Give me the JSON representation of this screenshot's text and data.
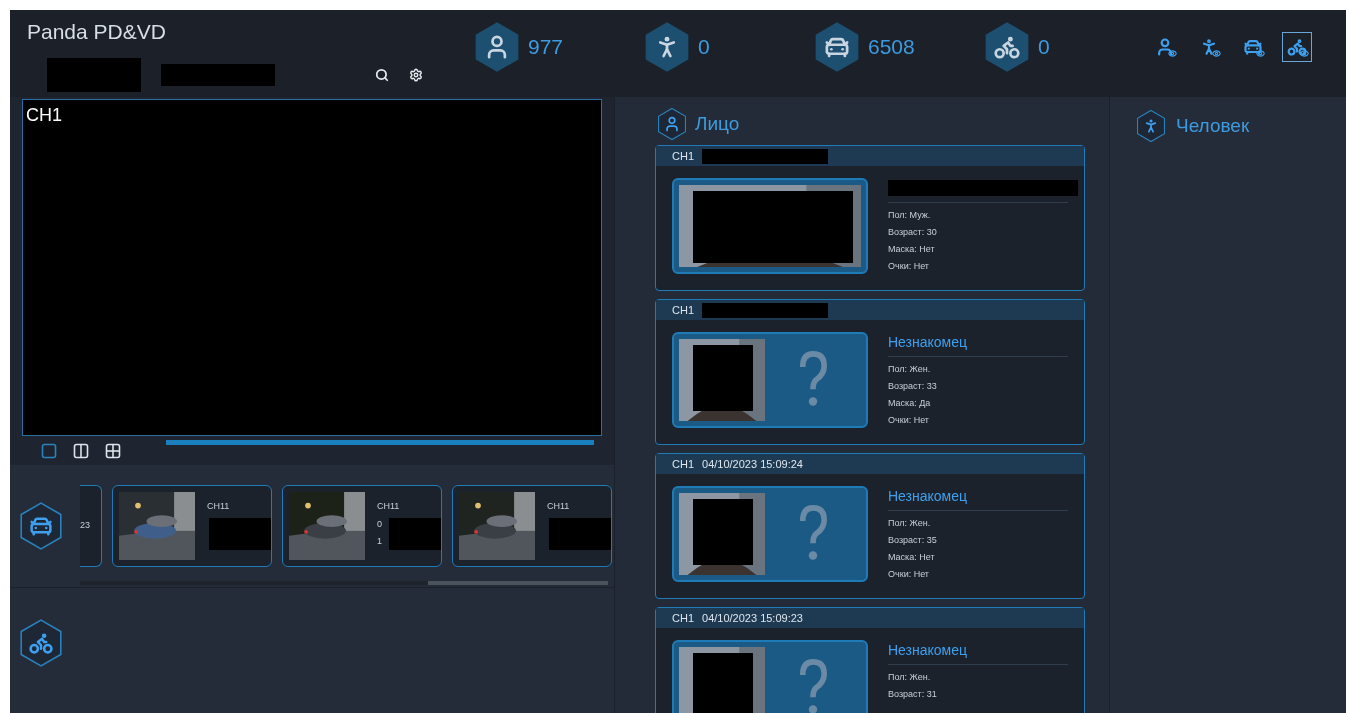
{
  "app_title": "Panda PD&VD",
  "counters": [
    {
      "kind": "face",
      "value": "977"
    },
    {
      "kind": "person",
      "value": "0"
    },
    {
      "kind": "car",
      "value": "6508"
    },
    {
      "kind": "motorcycle",
      "value": "0"
    }
  ],
  "filters": [
    {
      "kind": "face",
      "selected": false
    },
    {
      "kind": "person",
      "selected": false
    },
    {
      "kind": "car",
      "selected": false
    },
    {
      "kind": "motorcycle",
      "selected": true
    }
  ],
  "video": {
    "channel": "CH1"
  },
  "layouts": [
    {
      "kind": "single",
      "selected": true
    },
    {
      "kind": "split",
      "selected": false
    },
    {
      "kind": "quad",
      "selected": false
    }
  ],
  "vehicle_strip": {
    "kind": "car",
    "items": [
      {
        "partial": true,
        "lines": [
          "23"
        ]
      },
      {
        "partial": false,
        "channel": "CH11"
      },
      {
        "partial": false,
        "channel": "CH11",
        "lines": [
          "0",
          "1"
        ]
      },
      {
        "partial": false,
        "channel": "CH11"
      }
    ]
  },
  "moto_section": {
    "kind": "motorcycle"
  },
  "faces_panel": {
    "kind": "face",
    "title": "Лицо",
    "cards": [
      {
        "channel": "CH1",
        "time_redacted": true,
        "unknown": false,
        "attributes": [
          "Пол: Муж.",
          "Возраст: 30",
          "Маска: Нет",
          "Очки: Нет"
        ]
      },
      {
        "channel": "CH1",
        "time_redacted": true,
        "unknown": true,
        "name": "Незнакомец",
        "attributes": [
          "Пол: Жен.",
          "Возраст: 33",
          "Маска: Да",
          "Очки: Нет"
        ]
      },
      {
        "channel": "CH1",
        "time": "04/10/2023 15:09:24",
        "time_redacted": false,
        "unknown": true,
        "name": "Незнакомец",
        "attributes": [
          "Пол: Жен.",
          "Возраст: 35",
          "Маска: Нет",
          "Очки: Нет"
        ]
      },
      {
        "channel": "CH1",
        "time": "04/10/2023 15:09:23",
        "time_redacted": false,
        "unknown": true,
        "name": "Незнакомец",
        "attributes": [
          "Пол: Жен.",
          "Возраст: 31"
        ]
      }
    ]
  },
  "person_panel": {
    "kind": "person",
    "title": "Человек"
  }
}
